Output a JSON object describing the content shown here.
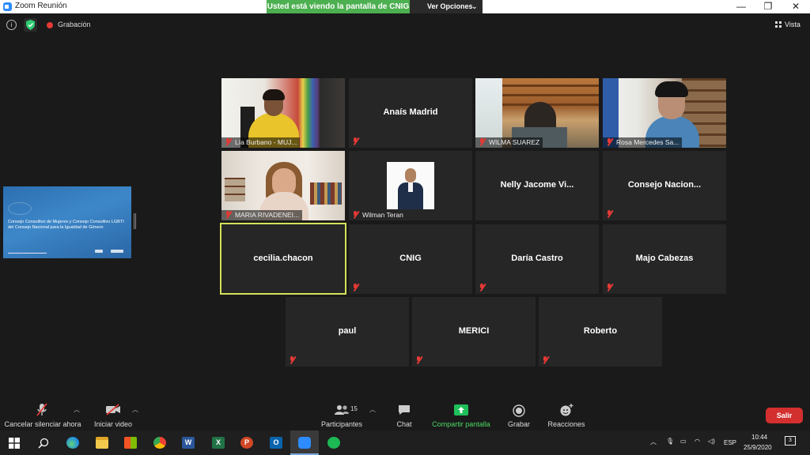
{
  "window": {
    "title": "Zoom Reunión",
    "share_banner": "Usted está viendo la pantalla de CNIG",
    "view_options": "Ver Opciones",
    "minimize": "—",
    "restore": "❐",
    "close": "✕"
  },
  "topbar": {
    "recording_label": "Grabación",
    "view_label": "Vista"
  },
  "shared_screen": {
    "title": "Consejo Consultivo de Mujeres y Consejo Consultivo LGBTI del Consejo Nacional para la Igualdad de Género"
  },
  "participants": [
    {
      "name": "Lía Burbano - MUJ...",
      "video": true
    },
    {
      "name": "Anaís Madrid",
      "video": false
    },
    {
      "name": "WILMA SUAREZ",
      "video": true
    },
    {
      "name": "Rosa Mercedes Sa...",
      "video": true
    },
    {
      "name": "MARIA RIVADENEI...",
      "video": true
    },
    {
      "name": "Wilman Teran",
      "video": false
    },
    {
      "name": "Nelly Jacome Vi...",
      "video": false
    },
    {
      "name": "Consejo Nacion...",
      "video": false
    },
    {
      "name": "cecilia.chacon",
      "video": false,
      "active_speaker": true
    },
    {
      "name": "CNIG",
      "video": false
    },
    {
      "name": "Daría Castro",
      "video": false
    },
    {
      "name": "Majo Cabezas",
      "video": false
    },
    {
      "name": "paul",
      "video": false
    },
    {
      "name": "MERICI",
      "video": false
    },
    {
      "name": "Roberto",
      "video": false
    }
  ],
  "toolbar": {
    "unmute": "Cancelar silenciar ahora",
    "start_video": "Iniciar video",
    "participants": "Participantes",
    "participants_count": "15",
    "chat": "Chat",
    "share_screen": "Compartir pantalla",
    "record": "Grabar",
    "reactions": "Reacciones",
    "leave": "Salir"
  },
  "taskbar": {
    "language": "ESP",
    "time": "10:44",
    "date": "25/9/2020",
    "notifications": "3"
  },
  "colors": {
    "share_banner": "#4caf50",
    "share_icon": "#1fbf5a",
    "active_speaker_border": "#d4e157",
    "leave_button": "#d32f2f",
    "muted_icon": "#e53935"
  }
}
